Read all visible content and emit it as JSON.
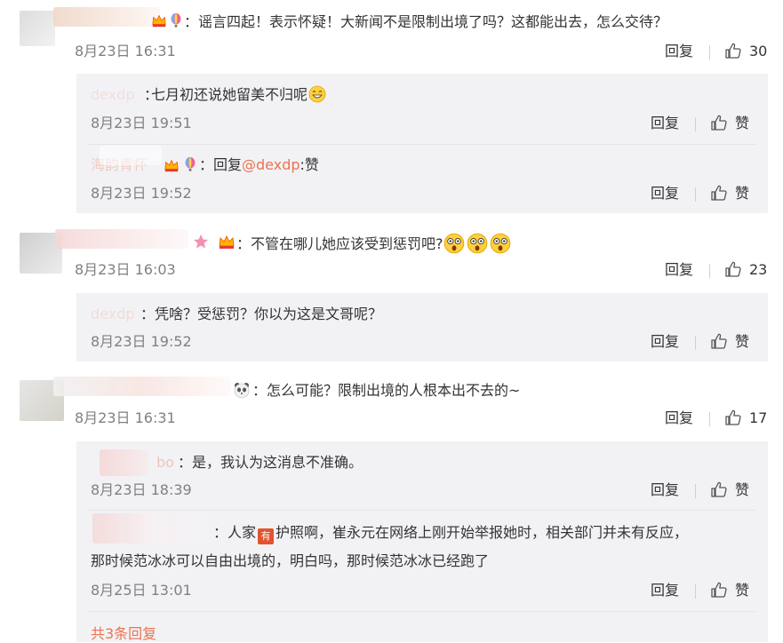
{
  "comments": [
    {
      "text": "：谣言四起！表示怀疑！大新闻不是限制出境了吗？这都能出去，怎么交待？",
      "time": "8月23日 16:31",
      "reply_label": "回复",
      "likes": "30",
      "replies": [
        {
          "name": "dexdp",
          "text": "七月初还说她留美不归呢",
          "time": "8月23日 19:51",
          "reply_label": "回复",
          "like_label": "赞"
        },
        {
          "name": "海韵青怀",
          "text_prefix": "：回复",
          "mention": "@dexdp",
          "text_suffix": ":赞",
          "time": "8月23日 19:52",
          "reply_label": "回复",
          "like_label": "赞"
        }
      ]
    },
    {
      "text": "：不管在哪儿她应该受到惩罚吧?",
      "time": "8月23日 16:03",
      "reply_label": "回复",
      "likes": "23",
      "replies": [
        {
          "name": "dexdp",
          "text": "：凭啥？受惩罚？你以为这是文哥呢？",
          "time": "8月23日 19:52",
          "reply_label": "回复",
          "like_label": "赞"
        }
      ]
    },
    {
      "text": "：怎么可能？限制出境的人根本出不去的~",
      "time": "8月23日 16:31",
      "reply_label": "回复",
      "likes": "17",
      "replies": [
        {
          "name": "bo",
          "text": "：是，我认为这消息不准确。",
          "time": "8月23日 18:39",
          "reply_label": "回复",
          "like_label": "赞"
        },
        {
          "name": "",
          "text_line1_a": "：人家",
          "badge": "有",
          "text_line1_b": "护照啊，崔永元在网络上刚开始举报她时，相关部门并未有反应，",
          "text_line2": "那时候范冰冰可以自由出境的，明白吗，那时候范冰冰已经跑了",
          "time": "8月25日 13:01",
          "reply_label": "回复",
          "like_label": "赞"
        }
      ]
    }
  ],
  "more_replies": "共3条回复",
  "colors": {
    "link": "#eb7350",
    "reply_bg": "#f2f2f5",
    "time": "#808080"
  }
}
